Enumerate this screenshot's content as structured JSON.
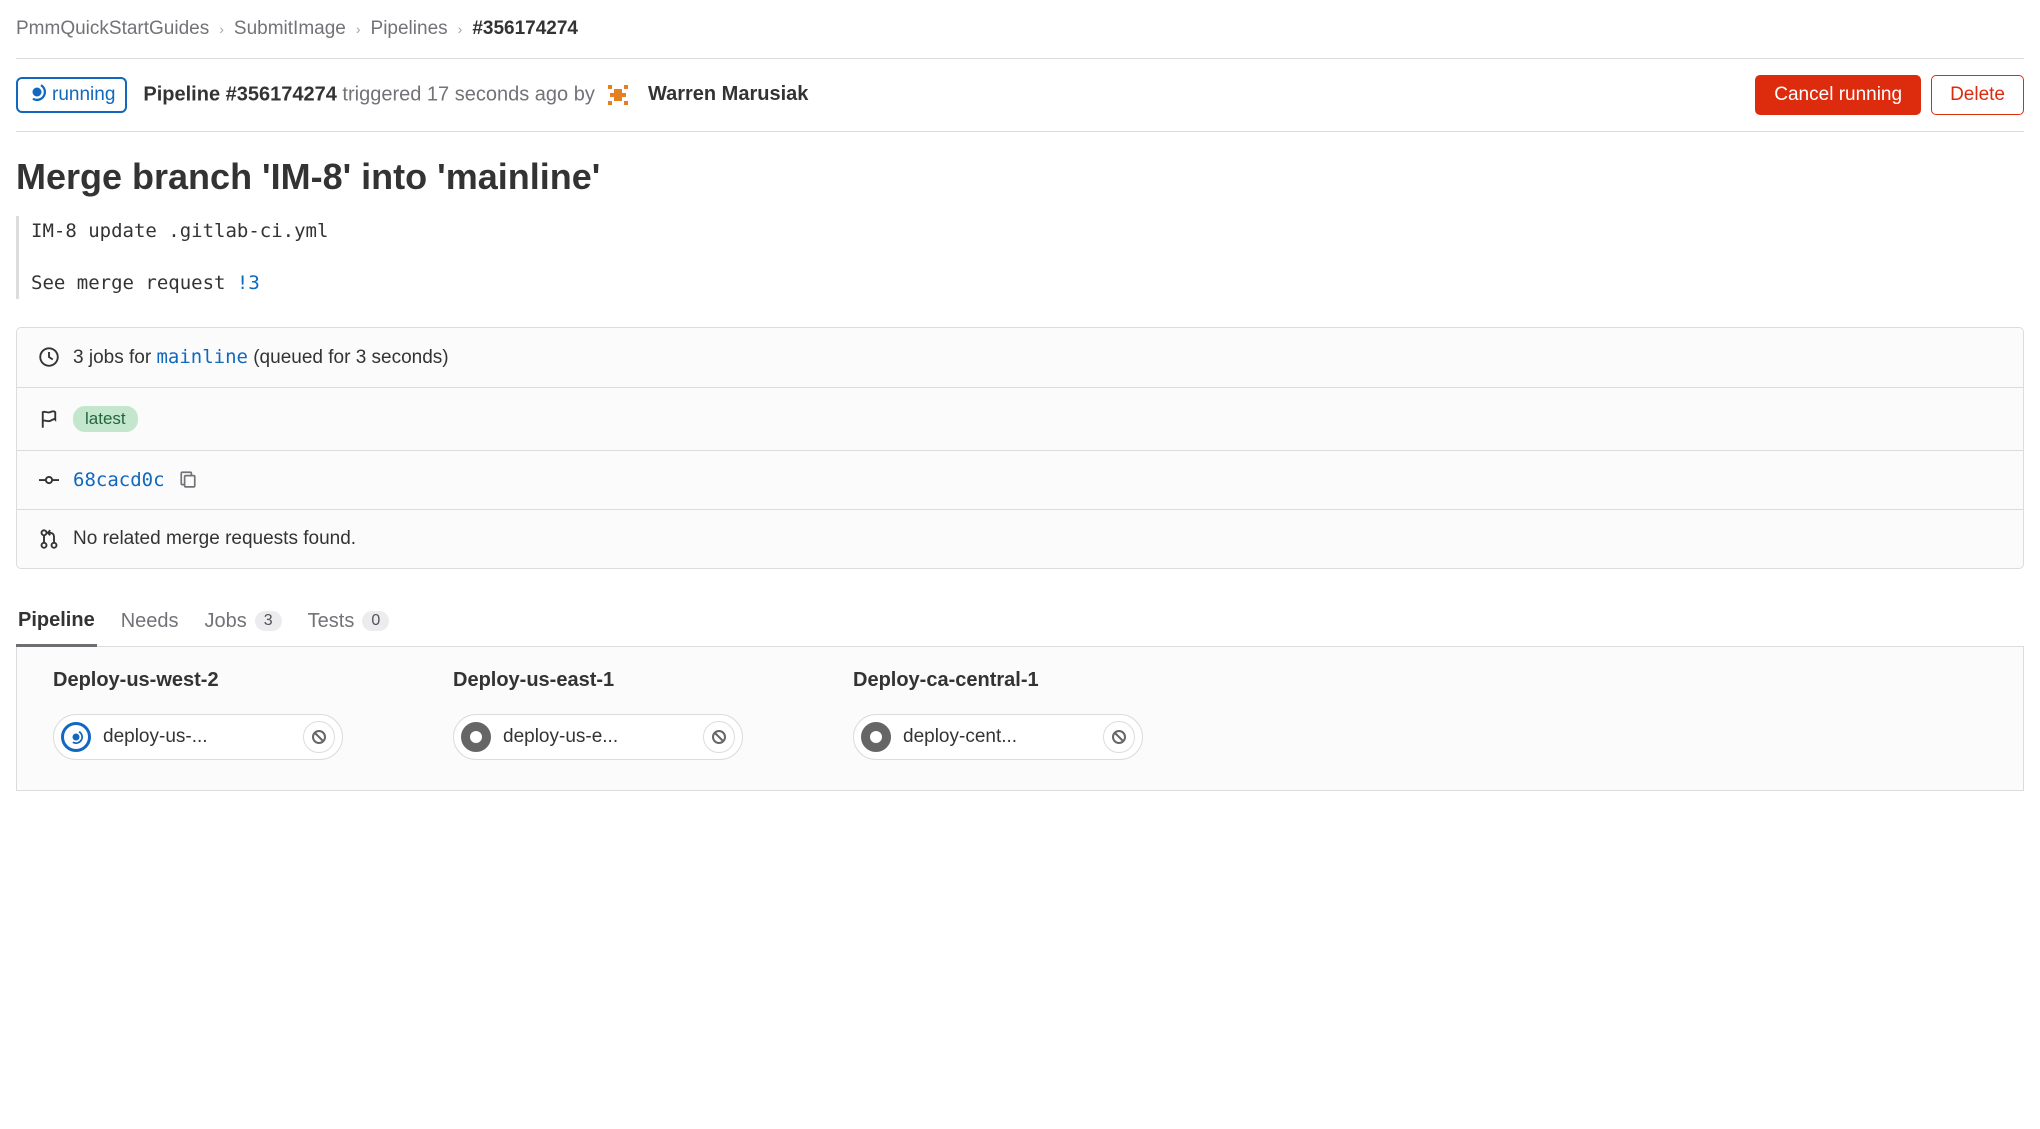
{
  "breadcrumb": {
    "items": [
      "PmmQuickStartGuides",
      "SubmitImage",
      "Pipelines",
      "#356174274"
    ]
  },
  "header": {
    "status_label": "running",
    "pipeline_label": "Pipeline #356174274",
    "triggered_text": " triggered 17 seconds ago by ",
    "user": "Warren Marusiak",
    "cancel_label": "Cancel running",
    "delete_label": "Delete"
  },
  "commit": {
    "title": "Merge branch 'IM-8' into 'mainline'",
    "body_line1": "IM-8 update .gitlab-ci.yml",
    "body_line2_prefix": "See merge request ",
    "mr_ref": "!3"
  },
  "info": {
    "jobs_prefix": "3 jobs for ",
    "branch": "mainline",
    "jobs_suffix": " (queued for 3 seconds)",
    "latest_badge": "latest",
    "commit_sha": "68cacd0c",
    "mr_text": "No related merge requests found."
  },
  "tabs": [
    {
      "label": "Pipeline",
      "active": true
    },
    {
      "label": "Needs"
    },
    {
      "label": "Jobs",
      "count": "3"
    },
    {
      "label": "Tests",
      "count": "0"
    }
  ],
  "stages": [
    {
      "name": "Deploy-us-west-2",
      "job": "deploy-us-...",
      "status": "running"
    },
    {
      "name": "Deploy-us-east-1",
      "job": "deploy-us-e...",
      "status": "manual"
    },
    {
      "name": "Deploy-ca-central-1",
      "job": "deploy-cent...",
      "status": "manual"
    }
  ]
}
